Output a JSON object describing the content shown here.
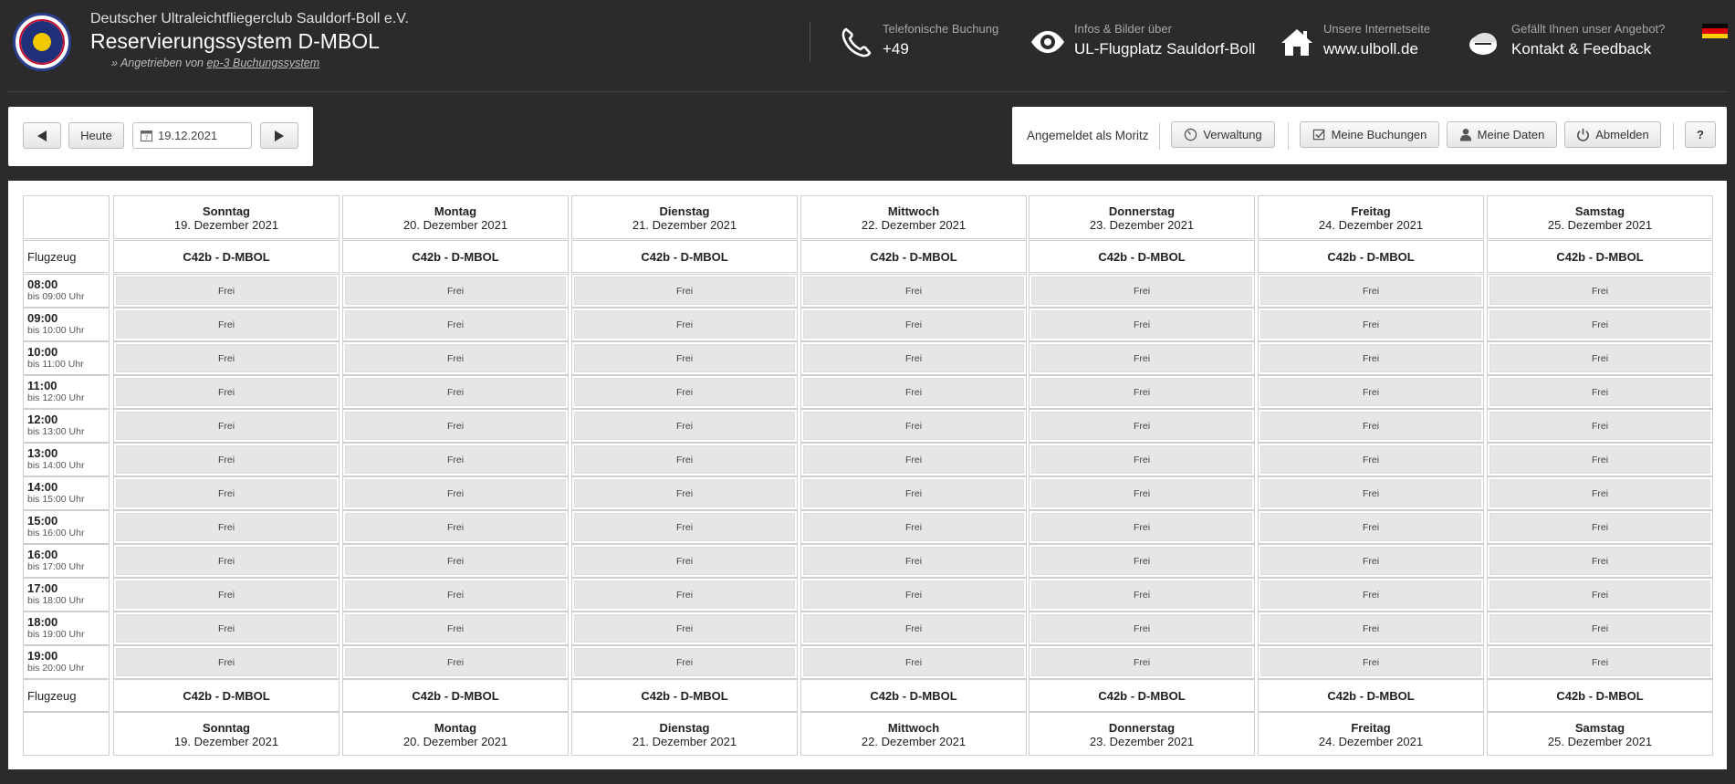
{
  "header": {
    "club_name": "Deutscher Ultraleichtfliegerclub Sauldorf-Boll e.V.",
    "system_title": "Reservierungssystem D-MBOL",
    "powered_prefix": "» Angetrieben von",
    "powered_link": "ep-3 Buchungssystem",
    "items": [
      {
        "icon": "phone-icon",
        "small": "Telefonische Buchung",
        "big": "+49"
      },
      {
        "icon": "eye-icon",
        "small": "Infos & Bilder über",
        "big": "UL-Flugplatz Sauldorf-Boll"
      },
      {
        "icon": "home-icon",
        "small": "Unsere Internetseite",
        "big": "www.ulboll.de"
      },
      {
        "icon": "feedback-icon",
        "small": "Gefällt Ihnen unser Angebot?",
        "big": "Kontakt & Feedback"
      }
    ],
    "flag_colors": [
      "#000000",
      "#dd0000",
      "#ffce00"
    ]
  },
  "nav": {
    "prev_icon": "arrow-left-icon",
    "today_label": "Heute",
    "date_value": "19.12.2021",
    "next_icon": "arrow-right-icon"
  },
  "user": {
    "logged_in_label": "Angemeldet als Moritz",
    "admin_label": "Verwaltung",
    "bookings_label": "Meine Buchungen",
    "data_label": "Meine Daten",
    "logout_label": "Abmelden",
    "help_label": "?"
  },
  "calendar": {
    "aircraft_label": "Flugzeug",
    "aircraft": "C42b - D-MBOL",
    "days": [
      {
        "weekday": "Sonntag",
        "date": "19. Dezember 2021"
      },
      {
        "weekday": "Montag",
        "date": "20. Dezember 2021"
      },
      {
        "weekday": "Dienstag",
        "date": "21. Dezember 2021"
      },
      {
        "weekday": "Mittwoch",
        "date": "22. Dezember 2021"
      },
      {
        "weekday": "Donnerstag",
        "date": "23. Dezember 2021"
      },
      {
        "weekday": "Freitag",
        "date": "24. Dezember 2021"
      },
      {
        "weekday": "Samstag",
        "date": "25. Dezember 2021"
      }
    ],
    "slots": [
      {
        "time": "08:00",
        "until": "bis 09:00 Uhr"
      },
      {
        "time": "09:00",
        "until": "bis 10:00 Uhr"
      },
      {
        "time": "10:00",
        "until": "bis 11:00 Uhr"
      },
      {
        "time": "11:00",
        "until": "bis 12:00 Uhr"
      },
      {
        "time": "12:00",
        "until": "bis 13:00 Uhr"
      },
      {
        "time": "13:00",
        "until": "bis 14:00 Uhr"
      },
      {
        "time": "14:00",
        "until": "bis 15:00 Uhr"
      },
      {
        "time": "15:00",
        "until": "bis 16:00 Uhr"
      },
      {
        "time": "16:00",
        "until": "bis 17:00 Uhr"
      },
      {
        "time": "17:00",
        "until": "bis 18:00 Uhr"
      },
      {
        "time": "18:00",
        "until": "bis 19:00 Uhr"
      },
      {
        "time": "19:00",
        "until": "bis 20:00 Uhr"
      }
    ],
    "free_label": "Frei"
  }
}
